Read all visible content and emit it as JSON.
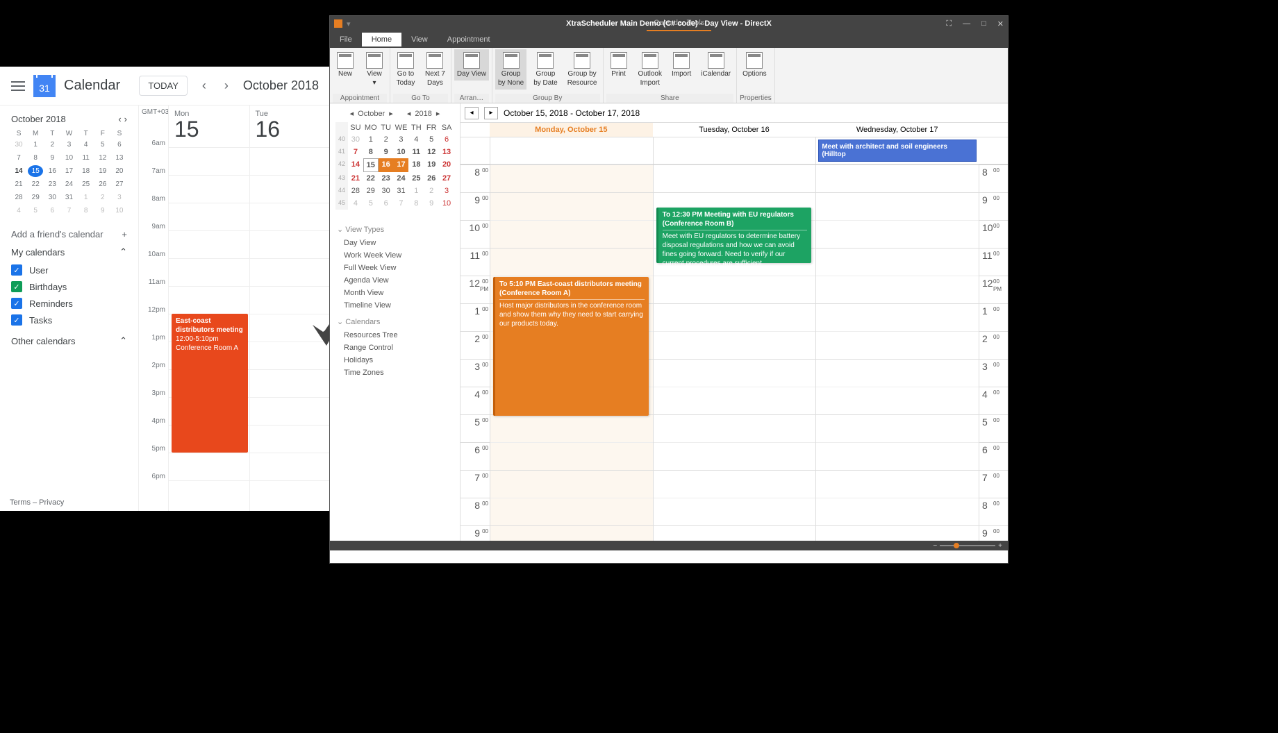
{
  "gcal": {
    "title": "Calendar",
    "logo_day": "31",
    "today": "TODAY",
    "month_label": "October 2018",
    "mini_month": "October 2018",
    "dow": [
      "S",
      "M",
      "T",
      "W",
      "T",
      "F",
      "S"
    ],
    "weeks": [
      [
        "30",
        "1",
        "2",
        "3",
        "4",
        "5",
        "6"
      ],
      [
        "7",
        "8",
        "9",
        "10",
        "11",
        "12",
        "13"
      ],
      [
        "14",
        "15",
        "16",
        "17",
        "18",
        "19",
        "20"
      ],
      [
        "21",
        "22",
        "23",
        "24",
        "25",
        "26",
        "27"
      ],
      [
        "28",
        "29",
        "30",
        "31",
        "1",
        "2",
        "3"
      ],
      [
        "4",
        "5",
        "6",
        "7",
        "8",
        "9",
        "10"
      ]
    ],
    "selected_day": "15",
    "add_friend": "Add a friend's calendar",
    "my_calendars": "My calendars",
    "other_calendars": "Other calendars",
    "calendars": [
      {
        "label": "User",
        "color": "#1a73e8"
      },
      {
        "label": "Birthdays",
        "color": "#0f9d58"
      },
      {
        "label": "Reminders",
        "color": "#1a73e8"
      },
      {
        "label": "Tasks",
        "color": "#1a73e8"
      }
    ],
    "terms": "Terms – Privacy",
    "timezone": "GMT+03",
    "hours": [
      "6am",
      "7am",
      "8am",
      "9am",
      "10am",
      "11am",
      "12pm",
      "1pm",
      "2pm",
      "3pm",
      "4pm",
      "5pm",
      "6pm"
    ],
    "days": [
      {
        "abbr": "Mon",
        "num": "15"
      },
      {
        "abbr": "Tue",
        "num": "16"
      }
    ],
    "event": {
      "title": "East-coast distributors meeting",
      "time": "12:00-5:10pm",
      "location": "Conference Room A"
    }
  },
  "xtra": {
    "window_title": "XtraScheduler Main Demo (C# code) - Day View - DirectX",
    "tools_label": "Calendar Tools",
    "tabs": [
      "File",
      "Home",
      "View",
      "Appointment"
    ],
    "active_tab": "Home",
    "ribbon": {
      "groups": [
        {
          "label": "Appointment",
          "buttons": [
            {
              "l1": "New",
              "l2": ""
            },
            {
              "l1": "View",
              "l2": "▾"
            }
          ]
        },
        {
          "label": "Go To",
          "buttons": [
            {
              "l1": "Go to",
              "l2": "Today"
            },
            {
              "l1": "Next 7",
              "l2": "Days"
            }
          ]
        },
        {
          "label": "Arran…",
          "buttons": [
            {
              "l1": "Day View",
              "l2": "",
              "sel": true
            }
          ]
        },
        {
          "label": "Group By",
          "buttons": [
            {
              "l1": "Group",
              "l2": "by None",
              "sel": true
            },
            {
              "l1": "Group",
              "l2": "by Date"
            },
            {
              "l1": "Group by",
              "l2": "Resource"
            }
          ]
        },
        {
          "label": "Share",
          "buttons": [
            {
              "l1": "Print",
              "l2": ""
            },
            {
              "l1": "Outlook",
              "l2": "Import"
            },
            {
              "l1": "Import",
              "l2": ""
            },
            {
              "l1": "iCalendar",
              "l2": ""
            }
          ]
        },
        {
          "label": "Properties",
          "buttons": [
            {
              "l1": "Options",
              "l2": ""
            }
          ]
        }
      ]
    },
    "mini": {
      "month": "October",
      "year": "2018",
      "dow": [
        "SU",
        "MO",
        "TU",
        "WE",
        "TH",
        "FR",
        "SA"
      ],
      "wk": [
        "40",
        "41",
        "42",
        "43",
        "44",
        "45"
      ],
      "weeks": [
        [
          "30",
          "1",
          "2",
          "3",
          "4",
          "5",
          "6"
        ],
        [
          "7",
          "8",
          "9",
          "10",
          "11",
          "12",
          "13"
        ],
        [
          "14",
          "15",
          "16",
          "17",
          "18",
          "19",
          "20"
        ],
        [
          "21",
          "22",
          "23",
          "24",
          "25",
          "26",
          "27"
        ],
        [
          "28",
          "29",
          "30",
          "31",
          "1",
          "2",
          "3"
        ],
        [
          "4",
          "5",
          "6",
          "7",
          "8",
          "9",
          "10"
        ]
      ]
    },
    "side": {
      "view_types": "View Types",
      "views": [
        "Day View",
        "Work Week View",
        "Full Week View",
        "Agenda View",
        "Month View",
        "Timeline View"
      ],
      "calendars_head": "Calendars",
      "calendars": [
        "Resources Tree",
        "Range Control",
        "Holidays",
        "Time Zones"
      ]
    },
    "date_range": "October 15, 2018 - October 17, 2018",
    "day_headers": [
      "Monday, October 15",
      "Tuesday, October 16",
      "Wednesday, October 17"
    ],
    "hours": [
      "8",
      "9",
      "10",
      "11",
      "12",
      "1",
      "2",
      "3",
      "4",
      "5",
      "6",
      "7",
      "8",
      "9"
    ],
    "events": {
      "mon": {
        "header": "To 5:10 PM East-coast distributors meeting (Conference Room A)",
        "body": "Host major distributors in the conference room and show them why they need to start carrying our products today."
      },
      "tue": {
        "header": "To 12:30 PM Meeting with EU regulators (Conference Room B)",
        "body": "Meet with EU regulators to determine battery disposal regulations and how we can avoid fines going forward. Need to verify if our current procedures are sufficient."
      },
      "wed_allday": "Meet with architect and soil engineers (Hilltop"
    }
  }
}
